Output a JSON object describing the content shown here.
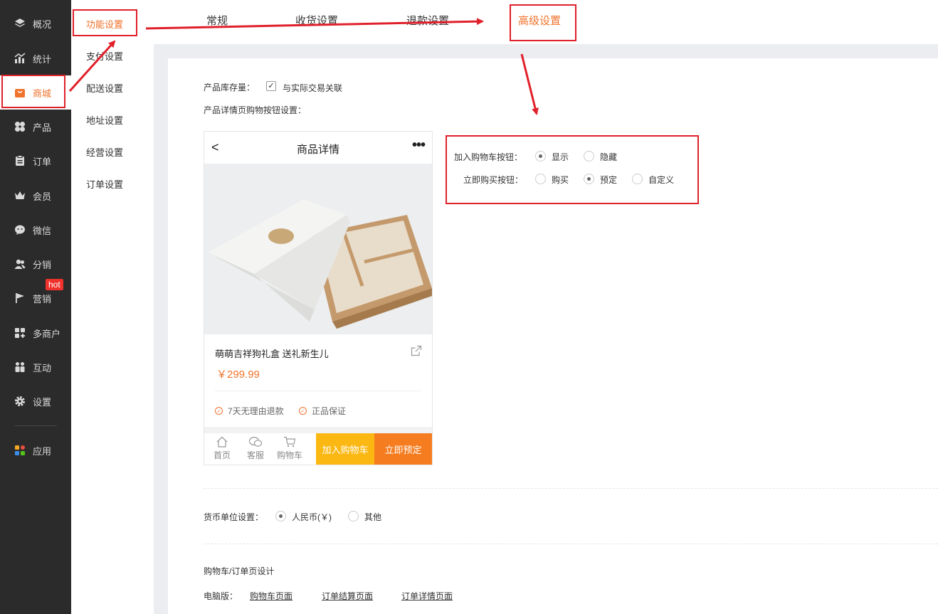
{
  "sidebar": {
    "items": [
      {
        "label": "概况",
        "icon": "layers-icon"
      },
      {
        "label": "统计",
        "icon": "chart-icon"
      },
      {
        "label": "商城",
        "icon": "shop-icon"
      },
      {
        "label": "产品",
        "icon": "grid-icon"
      },
      {
        "label": "订单",
        "icon": "clipboard-icon"
      },
      {
        "label": "会员",
        "icon": "crown-icon"
      },
      {
        "label": "微信",
        "icon": "chat-icon"
      },
      {
        "label": "分销",
        "icon": "users-icon"
      },
      {
        "label": "营销",
        "icon": "flag-icon"
      },
      {
        "label": "多商户",
        "icon": "store-icon"
      },
      {
        "label": "互动",
        "icon": "people-icon"
      },
      {
        "label": "设置",
        "icon": "gear-icon"
      },
      {
        "label": "应用",
        "icon": "apps-icon"
      }
    ],
    "active_index": 2,
    "hot_badge": "hot"
  },
  "subnav": {
    "items": [
      "功能设置",
      "支付设置",
      "配送设置",
      "地址设置",
      "经营设置",
      "订单设置"
    ],
    "active_index": 0
  },
  "tabs": {
    "items": [
      "常规",
      "收货设置",
      "退款设置",
      "高级设置"
    ],
    "active_index": 3
  },
  "settings": {
    "stock_label": "产品库存量：",
    "stock_checkbox_label": "与实际交易关联",
    "stock_checked": true,
    "buy_button_label": "产品详情页购物按钮设置：",
    "cart_button_label": "加入购物车按钮：",
    "cart_options": [
      "显示",
      "隐藏"
    ],
    "cart_selected": "显示",
    "buy_now_label": "立即购买按钮：",
    "buy_options": [
      "购买",
      "预定",
      "自定义"
    ],
    "buy_selected": "预定",
    "currency_label": "货币单位设置：",
    "currency_options": [
      "人民币(￥)",
      "其他"
    ],
    "currency_selected": "人民币(￥)",
    "design_label": "购物车/订单页设计",
    "pc_label": "电脑版：",
    "pc_links": [
      "购物车页面",
      "订单结算页面",
      "订单详情页面"
    ]
  },
  "phone_preview": {
    "title": "商品详情",
    "back_glyph": "<",
    "more_glyph": "•••",
    "product_name": "萌萌吉祥狗礼盒 送礼新生儿",
    "price": "￥299.99",
    "guarantees": [
      "7天无理由退款",
      "正品保证"
    ],
    "bottom_icons": [
      "首页",
      "客服",
      "购物车"
    ],
    "add_cart_button": "加入购物车",
    "buy_button": "立即预定"
  },
  "colors": {
    "accent": "#f0732c",
    "annotation_red": "#e0202a",
    "sidebar_bg": "#2b2b2b",
    "cart_button": "#fbb813",
    "buy_button": "#f57c1f"
  }
}
